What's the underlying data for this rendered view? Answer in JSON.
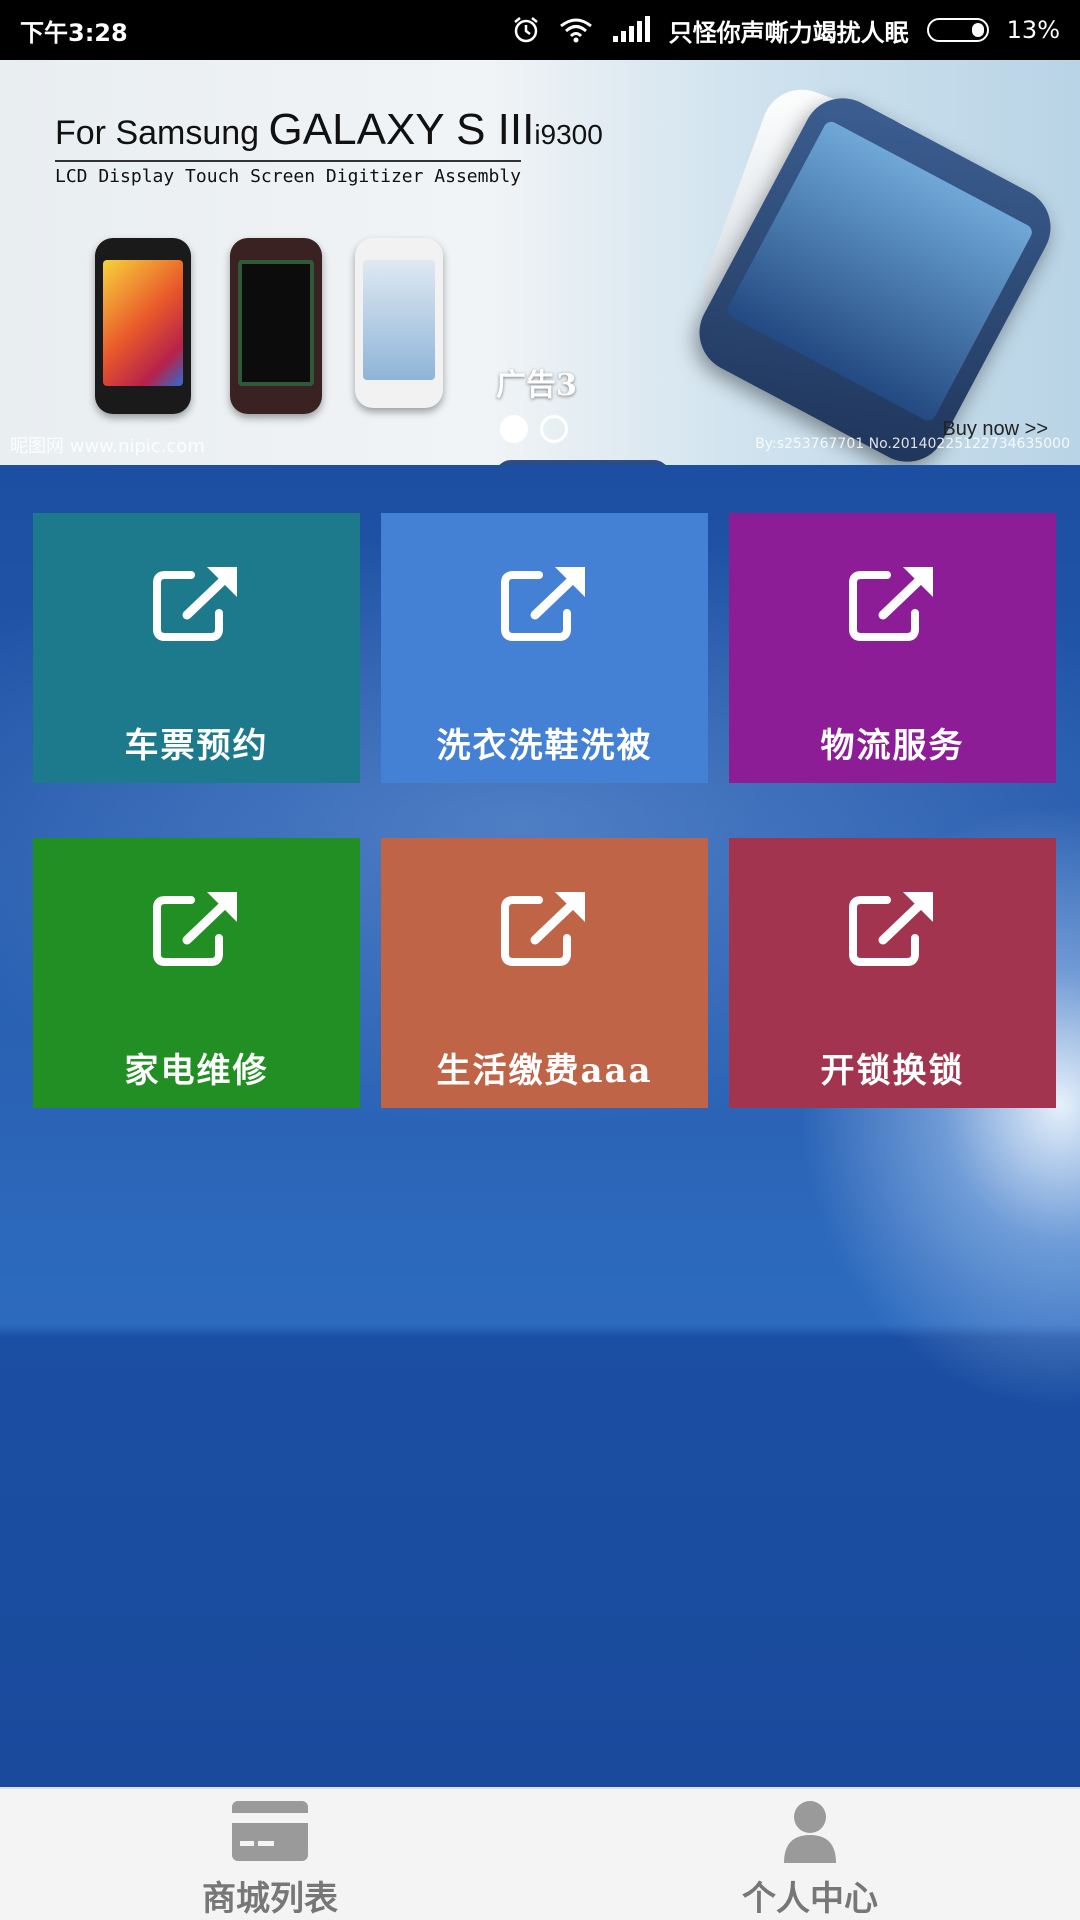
{
  "status_bar": {
    "time": "下午3:28",
    "carrier": "只怪你声嘶力竭扰人眠",
    "battery": "13%",
    "icons": [
      "alarm-icon",
      "wifi-icon",
      "signal-icon",
      "battery-icon"
    ]
  },
  "banner": {
    "brand": "For Samsung",
    "product": "GALAXY S III",
    "model": "i9300",
    "subtitle": "LCD Display Touch Screen Digitizer Assembly",
    "buy_now": "Buy now >>",
    "watermark_left": "昵图网 www.nipic.com",
    "watermark_right": "By:s253767701 No.20140225122734635000",
    "ad_label": "广告3",
    "page_count": 2,
    "active_page": 0
  },
  "tiles": [
    {
      "label": "车票预约",
      "color": "#1d7a8c",
      "icon": "external-link-icon"
    },
    {
      "label": "洗衣洗鞋洗被",
      "color": "#4480d4",
      "icon": "external-link-icon"
    },
    {
      "label": "物流服务",
      "color": "#8d1d97",
      "icon": "external-link-icon"
    },
    {
      "label": "家电维修",
      "color": "#218f23",
      "icon": "external-link-icon"
    },
    {
      "label": "生活缴费aaa",
      "color": "#c06448",
      "icon": "external-link-icon"
    },
    {
      "label": "开锁换锁",
      "color": "#a2344f",
      "icon": "external-link-icon"
    }
  ],
  "bottom_nav": {
    "items": [
      {
        "label": "商城列表",
        "icon": "card-icon"
      },
      {
        "label": "个人中心",
        "icon": "person-icon"
      }
    ],
    "icon_color": "#9a9a9a",
    "label_color": "#777777"
  }
}
